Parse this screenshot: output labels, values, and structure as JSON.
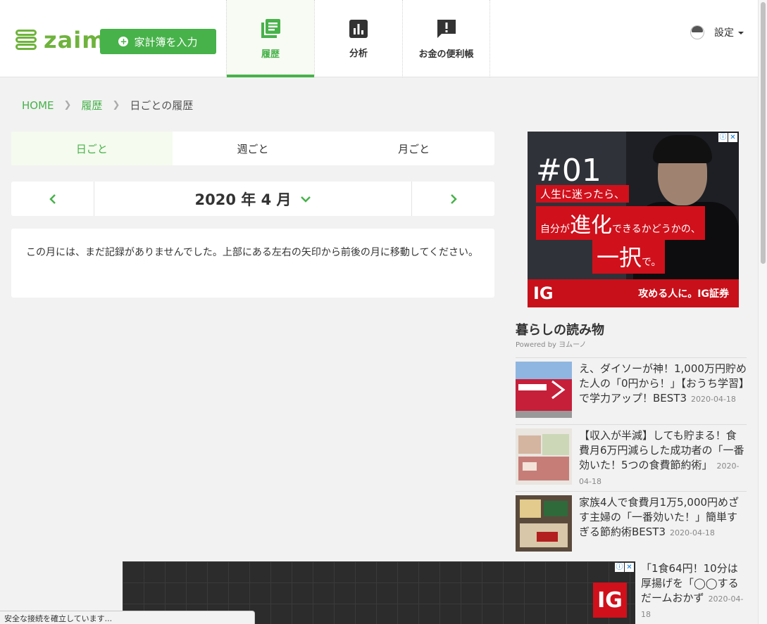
{
  "header": {
    "logo_text": "zaim",
    "input_button_label": "家計簿を入力",
    "nav": [
      {
        "label": "履歴",
        "icon": "history-book-icon",
        "active": true
      },
      {
        "label": "分析",
        "icon": "bar-chart-icon",
        "active": false
      },
      {
        "label": "お金の便利帳",
        "icon": "alert-bubble-icon",
        "active": false
      }
    ],
    "settings_label": "設定"
  },
  "breadcrumb": {
    "home": "HOME",
    "history": "履歴",
    "current": "日ごとの履歴"
  },
  "period_tabs": [
    {
      "label": "日ごと",
      "active": true
    },
    {
      "label": "週ごと",
      "active": false
    },
    {
      "label": "月ごと",
      "active": false
    }
  ],
  "month_selector": {
    "label": "2020 年 4 月"
  },
  "notice": {
    "text": "この月には、まだ記録がありませんでした。上部にある左右の矢印から前後の月に移動してください。"
  },
  "sidebar_ad": {
    "number": "#01",
    "line1": "人生に迷ったら、",
    "line2_pre": "自分が",
    "line2_big": "進化",
    "line2_post": "できるかどうかの、",
    "line3_big": "一択",
    "line3_post": "で。",
    "brand": "IG",
    "footer_copy": "攻める人に。IG証券"
  },
  "reads": {
    "title": "暮らしの読み物",
    "powered_by": "Powered by ヨムーノ",
    "items": [
      {
        "text": "え、ダイソーが神！1,000万円貯めた人の「0円から！」【おうち学習】で学力アップ！BEST3",
        "date": "2020-04-18"
      },
      {
        "text": "【収入が半減】しても貯まる！食費月6万円減らした成功者の「一番効いた！5つの食費節約術」",
        "date": "2020-04-18"
      },
      {
        "text": "家族4人で食費月1万5,000円めざす主婦の「一番効いた！」簡単すぎる節約術BEST3",
        "date": "2020-04-18"
      }
    ],
    "partial_item": {
      "text": "「1食64円！10分は厚揚げを「◯◯するだームおかず",
      "date": "2020-04-18"
    }
  },
  "bottom_ad": {
    "brand": "IG"
  },
  "status_bar": {
    "text": "安全な接続を確立しています..."
  },
  "colors": {
    "brand_green": "#47b24a",
    "ad_red": "#d0101b"
  }
}
